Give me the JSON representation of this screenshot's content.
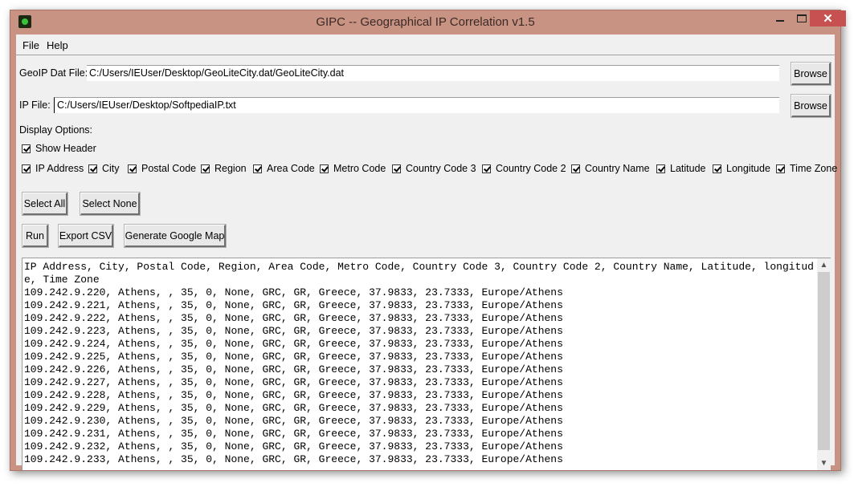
{
  "window": {
    "title": "GIPC -- Geographical IP Correlation v1.5",
    "close_glyph": "✕"
  },
  "menu": [
    "File",
    "Help"
  ],
  "geoip": {
    "label": "GeoIP Dat File:",
    "value": "C:/Users/IEUser/Desktop/GeoLiteCity.dat/GeoLiteCity.dat",
    "browse_label": "Browse"
  },
  "ipfile": {
    "label": "IP File:",
    "value": "C:/Users/IEUser/Desktop/SoftpediaIP.txt",
    "browse_label": "Browse"
  },
  "display_options": {
    "heading": "Display Options:",
    "show_header": {
      "label": "Show Header",
      "checked": true
    },
    "fields": [
      {
        "label": "IP Address",
        "checked": true
      },
      {
        "label": "City",
        "checked": true
      },
      {
        "label": "Postal Code",
        "checked": true
      },
      {
        "label": "Region",
        "checked": true
      },
      {
        "label": "Area Code",
        "checked": true
      },
      {
        "label": "Metro Code",
        "checked": true
      },
      {
        "label": "Country Code 3",
        "checked": true
      },
      {
        "label": "Country Code 2",
        "checked": true
      },
      {
        "label": "Country Name",
        "checked": true
      },
      {
        "label": "Latitude",
        "checked": true
      },
      {
        "label": "Longitude",
        "checked": true
      },
      {
        "label": "Time Zone",
        "checked": true
      }
    ]
  },
  "buttons": {
    "select_all": "Select All",
    "select_none": "Select None",
    "run": "Run",
    "export_csv": "Export CSV",
    "google_map": "Generate Google Map"
  },
  "output": {
    "header": "IP Address, City, Postal Code, Region, Area Code, Metro Code, Country Code 3, Country Code 2, Country Name, Latitude, longitude, Time Zone",
    "rows": [
      "109.242.9.220, Athens, , 35, 0, None, GRC, GR, Greece, 37.9833, 23.7333, Europe/Athens",
      "109.242.9.221, Athens, , 35, 0, None, GRC, GR, Greece, 37.9833, 23.7333, Europe/Athens",
      "109.242.9.222, Athens, , 35, 0, None, GRC, GR, Greece, 37.9833, 23.7333, Europe/Athens",
      "109.242.9.223, Athens, , 35, 0, None, GRC, GR, Greece, 37.9833, 23.7333, Europe/Athens",
      "109.242.9.224, Athens, , 35, 0, None, GRC, GR, Greece, 37.9833, 23.7333, Europe/Athens",
      "109.242.9.225, Athens, , 35, 0, None, GRC, GR, Greece, 37.9833, 23.7333, Europe/Athens",
      "109.242.9.226, Athens, , 35, 0, None, GRC, GR, Greece, 37.9833, 23.7333, Europe/Athens",
      "109.242.9.227, Athens, , 35, 0, None, GRC, GR, Greece, 37.9833, 23.7333, Europe/Athens",
      "109.242.9.228, Athens, , 35, 0, None, GRC, GR, Greece, 37.9833, 23.7333, Europe/Athens",
      "109.242.9.229, Athens, , 35, 0, None, GRC, GR, Greece, 37.9833, 23.7333, Europe/Athens",
      "109.242.9.230, Athens, , 35, 0, None, GRC, GR, Greece, 37.9833, 23.7333, Europe/Athens",
      "109.242.9.231, Athens, , 35, 0, None, GRC, GR, Greece, 37.9833, 23.7333, Europe/Athens",
      "109.242.9.232, Athens, , 35, 0, None, GRC, GR, Greece, 37.9833, 23.7333, Europe/Athens",
      "109.242.9.233, Athens, , 35, 0, None, GRC, GR, Greece, 37.9833, 23.7333, Europe/Athens"
    ]
  }
}
